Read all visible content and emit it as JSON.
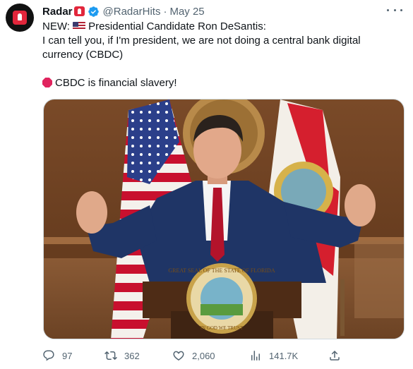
{
  "author": {
    "name": "Radar",
    "handle": "@RadarHits",
    "separator": "·",
    "date": "May 25",
    "avatar_icon": "siren-icon"
  },
  "tweet": {
    "line1_prefix": "NEW:",
    "line1_rest": "Presidential Candidate Ron DeSantis:",
    "line2": "I can tell you, if I'm president, we are not doing a central bank digital currency (CBDC)",
    "line3": "CBDC is financial slavery!"
  },
  "media": {
    "podium_seal_lines": [
      "GREAT SEAL OF THE STATE OF FLORIDA",
      "IN GOD WE TRUST"
    ]
  },
  "actions": {
    "replies": "97",
    "retweets": "362",
    "likes": "2,060",
    "views": "141.7K"
  },
  "colors": {
    "text": "#0f1419",
    "muted": "#536471",
    "verified": "#1d9bf0",
    "suit": "#1f3566",
    "tie": "#b3132b"
  }
}
